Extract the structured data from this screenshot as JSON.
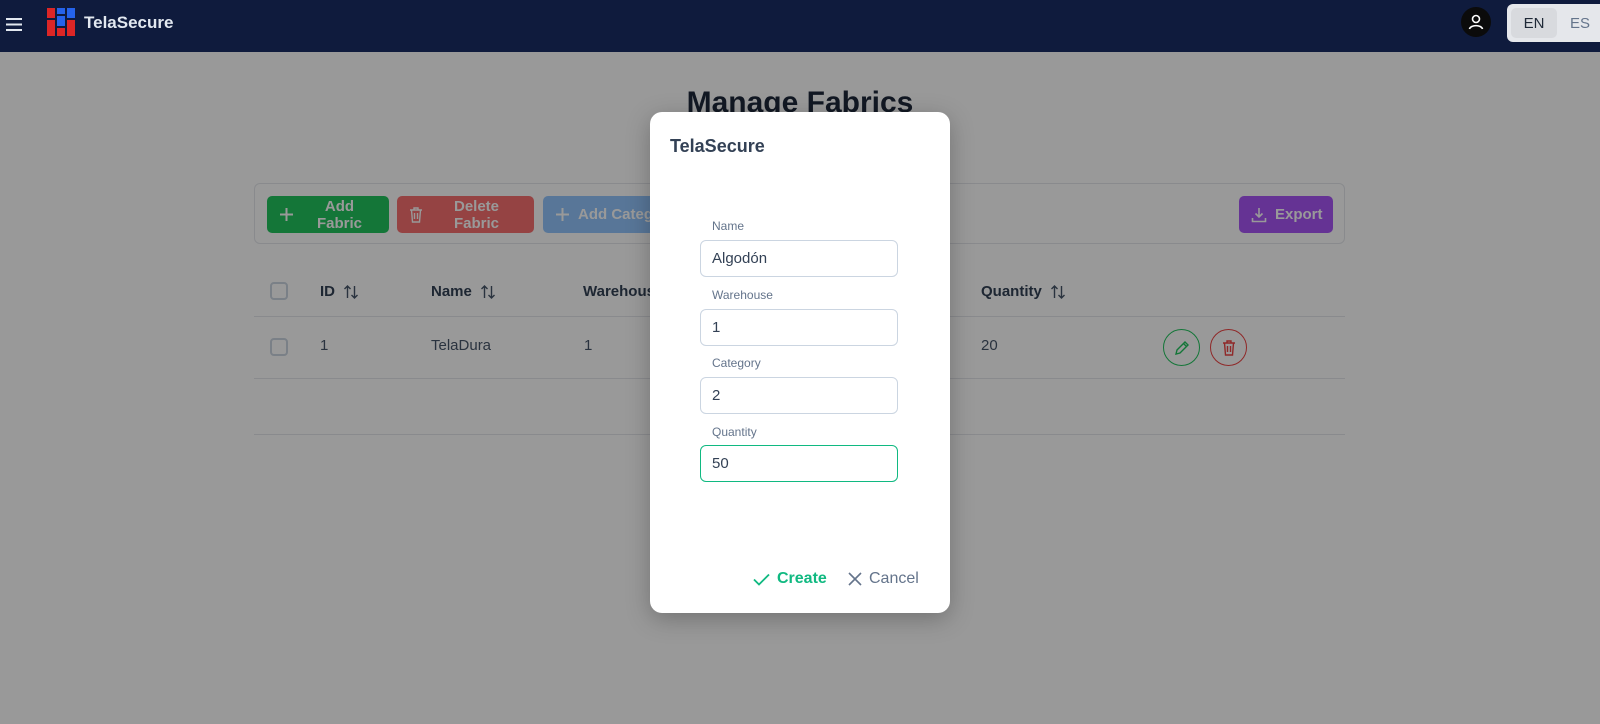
{
  "app": {
    "brand": "TelaSecure"
  },
  "header": {
    "languages": [
      {
        "code": "EN",
        "active": true
      },
      {
        "code": "ES",
        "active": false
      }
    ]
  },
  "page": {
    "title": "Manage Fabrics"
  },
  "toolbar": {
    "add_fabric": "Add Fabric",
    "delete_fabric": "Delete Fabric",
    "add_category": "Add Categ",
    "export": "Export"
  },
  "table": {
    "columns": {
      "id": "ID",
      "name": "Name",
      "warehouse": "Warehous",
      "quantity": "Quantity"
    },
    "rows": [
      {
        "id": "1",
        "name": "TelaDura",
        "warehouse": "1",
        "quantity": "20"
      }
    ]
  },
  "dialog": {
    "title": "TelaSecure",
    "fields": {
      "name": {
        "label": "Name",
        "value": "Algodón"
      },
      "warehouse": {
        "label": "Warehouse",
        "value": "1"
      },
      "category": {
        "label": "Category",
        "value": "2"
      },
      "quantity": {
        "label": "Quantity",
        "value": "50"
      }
    },
    "create": "Create",
    "cancel": "Cancel"
  },
  "colors": {
    "topbar": "#0f1b3d",
    "success": "#22c55e",
    "danger": "#f87171",
    "info": "#93c5fd",
    "export": "#a855f7",
    "accent": "#10b981"
  },
  "icons": {
    "menu": "hamburger-icon",
    "logo": "telasecure-logo",
    "user": "user-icon",
    "add": "plus-icon",
    "delete": "trash-icon",
    "export": "download-icon",
    "sort": "sort-icon",
    "edit": "pencil-icon",
    "check": "check-icon",
    "close": "close-icon"
  }
}
